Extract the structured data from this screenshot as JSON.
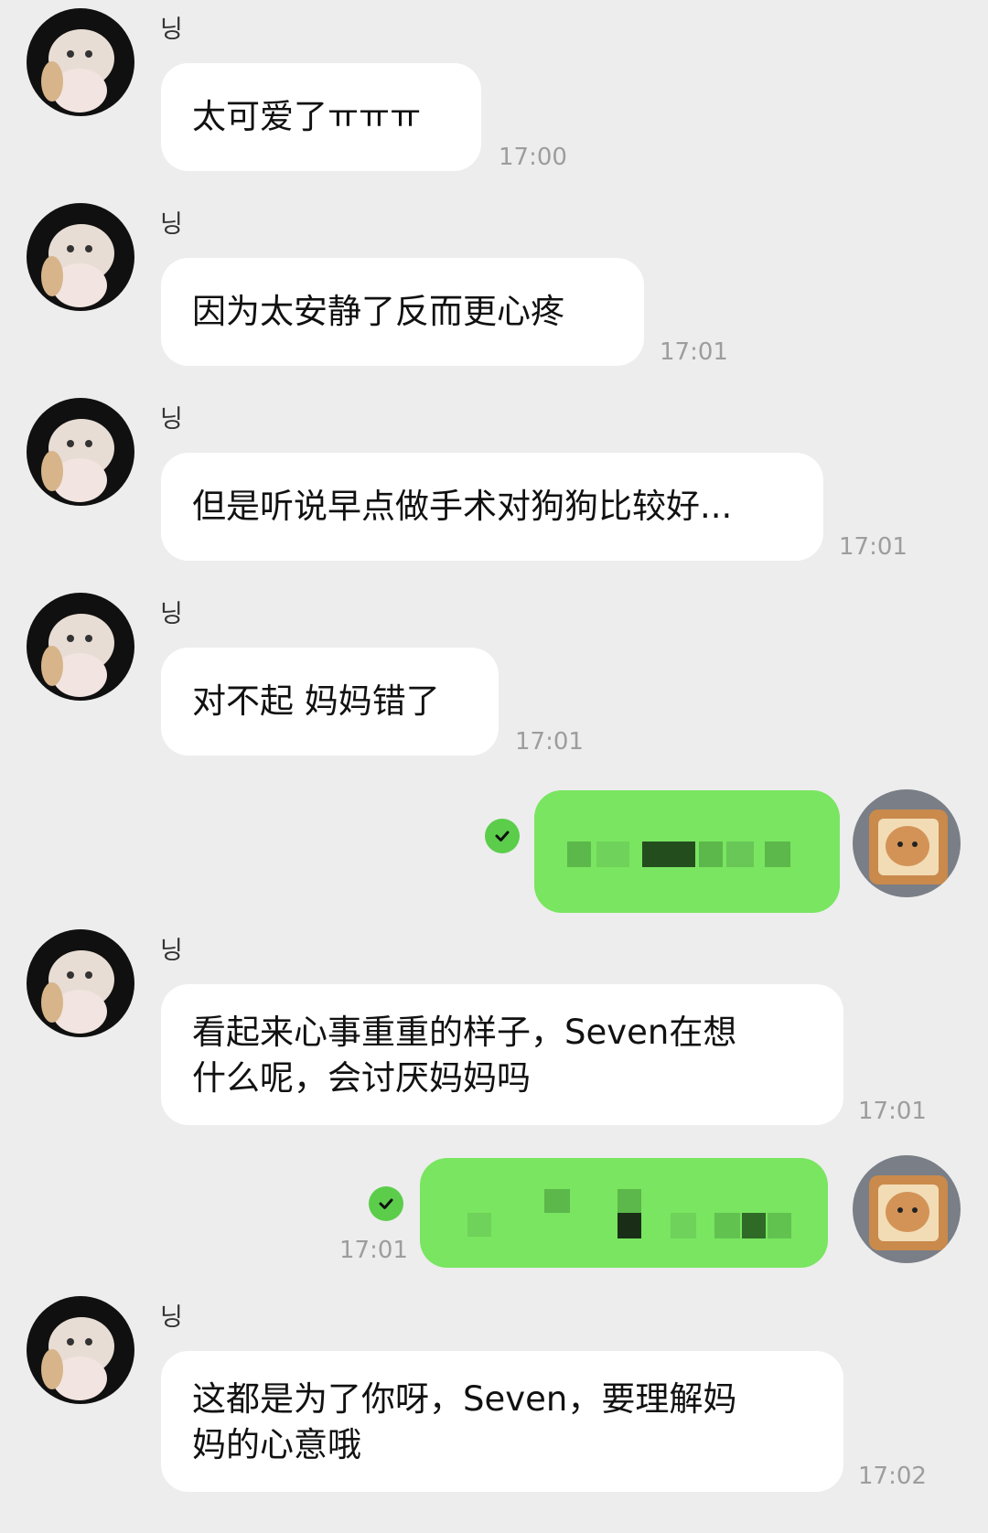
{
  "messages": [
    {
      "sender": "닝",
      "text": "太可爱了ㅠㅠㅠ",
      "time": "17:00"
    },
    {
      "sender": "닝",
      "text": "因为太安静了反而更心疼",
      "time": "17:01"
    },
    {
      "sender": "닝",
      "text": "但是听说早点做手术对狗狗比较好...",
      "time": "17:01"
    },
    {
      "sender": "닝",
      "text": "对不起 妈妈错了",
      "time": "17:01"
    },
    {
      "sender": "닝",
      "text_line1": "看起来心事重重的样子，Seven在想",
      "text_line2": "什么呢，会讨厌妈妈吗",
      "time": "17:01"
    },
    {
      "sender": "닝",
      "text_line1": "这都是为了你呀，Seven，要理解妈",
      "text_line2": "妈的心意哦",
      "time": "17:02"
    }
  ],
  "sent": [
    {
      "status": "read",
      "time": ""
    },
    {
      "status": "read",
      "time": "17:01"
    }
  ],
  "colors": {
    "background": "#ededed",
    "incoming_bubble": "#ffffff",
    "outgoing_bubble": "#79e561",
    "read_check": "#5bcd4b"
  },
  "icons": {
    "left_avatar": "white-persian-cat-avatar",
    "right_avatar": "kitten-in-bread-avatar",
    "check": "check-circle-icon"
  }
}
